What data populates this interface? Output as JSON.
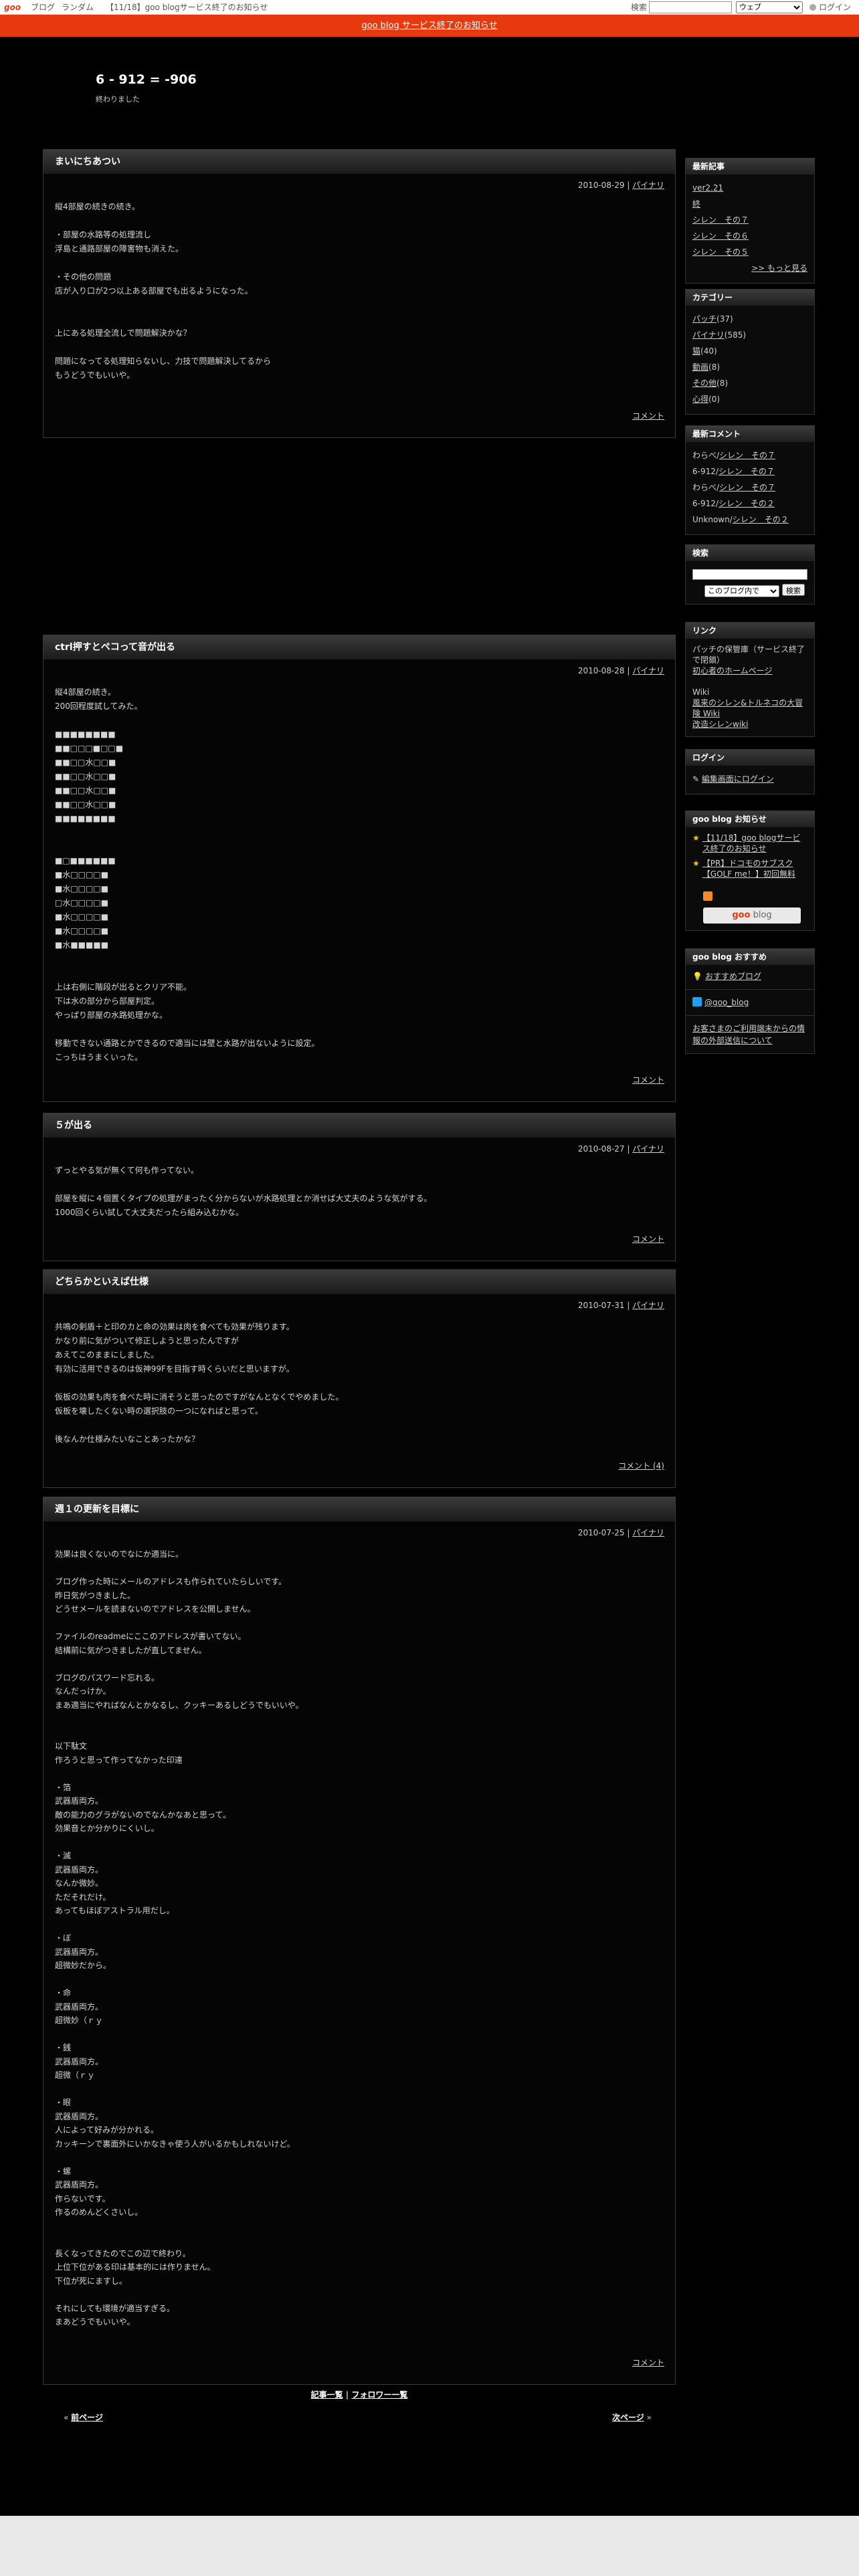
{
  "topbar": {
    "logo": "goo",
    "links": [
      "ブログ",
      "ランダム",
      "【11/18】goo blogサービス終了のお知らせ"
    ],
    "search_label": "検索",
    "search_select": "ウェブ",
    "login": "ログイン"
  },
  "notice": "goo blog サービス終了のお知らせ",
  "blog": {
    "title": "6 - 912 = -906",
    "description": "終わりました"
  },
  "entries": [
    {
      "title": "まいにちあつい",
      "date": "2010-08-29",
      "author": "パイナリ",
      "body": "縦4部屋の続きの続き。\n\n・部屋の水路等の処理流し\n浮島と通路部屋の障害物も消えた。\n\n・その他の問題\n店が入り口が2つ以上ある部屋でも出るようになった。\n\n\n上にある処理全流しで問題解決かな？\n\n問題になってる処理知らないし、力技で問題解決してるから\nもうどうでもいいや。",
      "comment": "コメント"
    },
    {
      "title": "ctrl押すとペコって音が出る",
      "date": "2010-08-28",
      "author": "パイナリ",
      "body": "縦4部屋の続き。\n200回程度試してみた。\n\n■■■■■■■■\n■■□□□■□□■\n■■□□水□□■\n■■□□水□□■\n■■□□水□□■\n■■□□水□□■\n■■■■■■■■\n\n\n■□■■■■■■\n■水□□□□■\n■水□□□□■\n□水□□□□■\n■水□□□□■\n■水□□□□■\n■水■■■■■\n\n\n上は右側に階段が出るとクリア不能。\n下は水の部分から部屋判定。\nやっぱり部屋の水路処理かな。\n\n移動できない通路とかできるので適当には壁と水路が出ないように設定。\nこっちはうまくいった。",
      "comment": "コメント"
    },
    {
      "title": "５が出る",
      "date": "2010-08-27",
      "author": "パイナリ",
      "body": "ずっとやる気が無くて何も作ってない。\n\n部屋を縦に４個置くタイプの処理がまったく分からないが水路処理とか消せば大丈夫のような気がする。\n1000回くらい試して大丈夫だったら組み込むかな。",
      "comment": "コメント"
    },
    {
      "title": "どちらかといえば仕様",
      "date": "2010-07-31",
      "author": "パイナリ",
      "body": "共鳴の剣盾＋と印のカと命の効果は肉を食べても効果が残ります。\nかなり前に気がついて修正しようと思ったんですが\nあえてこのままにしました。\n有効に活用できるのは仮神99Fを目指す時くらいだと思いますが。\n\n仮板の効果も肉を食べた時に消そうと思ったのですがなんとなくでやめました。\n仮板を壊したくない時の選択肢の一つになればと思って。\n\n後なんか仕様みたいなことあったかな？",
      "comment": "コメント (4)"
    },
    {
      "title": "週１の更新を目標に",
      "date": "2010-07-25",
      "author": "パイナリ",
      "body": "効果は良くないのでなにか適当に。\n\nブログ作った時にメールのアドレスも作られていたらしいです。\n昨日気がつきました。\nどうせメールを読まないのでアドレスを公開しません。\n\nファイルのreadmeにここのアドレスが書いてない。\n結構前に気がつきましたが直してません。\n\nブログのパスワード忘れる。\nなんだっけか。\nまあ適当にやればなんとかなるし、クッキーあるしどうでもいいや。\n\n\n以下駄文\n作ろうと思って作ってなかった印達\n\n・箔\n武器盾両方。\n敵の能力のグラがないのでなんかなあと思って。\n効果音とか分かりにくいし。\n\n・滅\n武器盾両方。\nなんか微妙。\nただそれだけ。\nあってもほぼアストラル用だし。\n\n・ぼ\n武器盾両方。\n超微妙だから。\n\n・命\n武器盾両方。\n超微妙（ｒｙ\n\n・銭\n武器盾両方。\n超微（ｒｙ\n\n・眼\n武器盾両方。\n人によって好みが分かれる。\nカッキーンで裏面外にいかなきゃ使う人がいるかもしれないけど。\n\n・螺\n武器盾両方。\n作らないです。\n作るのめんどくさいし。\n\n\n長くなってきたのでこの辺で終わり。\n上位下位がある印は基本的には作りません。\n下位が死にますし。\n\nそれにしても環境が適当すぎる。\nまあどうでもいいや。",
      "comment": "コメント"
    }
  ],
  "sidebar": {
    "recent_title": "最新記事",
    "recent": [
      "ver2.21",
      "終",
      "シレン　その７",
      "シレン　その６",
      "シレン　その５"
    ],
    "recent_more": ">> もっと見る",
    "category_title": "カテゴリー",
    "categories": [
      {
        "name": "パッチ",
        "count": "(37)"
      },
      {
        "name": "パイナリ",
        "count": "(585)"
      },
      {
        "name": "猫",
        "count": "(40)"
      },
      {
        "name": "動画",
        "count": "(8)"
      },
      {
        "name": "その他",
        "count": "(8)"
      },
      {
        "name": "心得",
        "count": "(0)"
      }
    ],
    "comments_title": "最新コメント",
    "comments": [
      {
        "who": "わらべ/",
        "link": "シレン　その７"
      },
      {
        "who": "6-912/",
        "link": "シレン　その７"
      },
      {
        "who": "わらべ/",
        "link": "シレン　その７"
      },
      {
        "who": "6-912/",
        "link": "シレン　その２"
      },
      {
        "who": "Unknown/",
        "link": "シレン　その２"
      }
    ],
    "search_title": "検索",
    "search_select": "このブログ内で",
    "search_button": "検索",
    "links_title": "リンク",
    "links": [
      "パッチの保管庫（サービス終了で閉鎖）",
      "初心者のホームページ",
      "",
      "Wiki",
      "風来のシレン&トルネコの大冒険 Wiki",
      "改造シレンwiki"
    ],
    "login_title": "ログイン",
    "login_link": "編集画面にログイン",
    "news_title": "goo blog お知らせ",
    "news": [
      "【11/18】goo blogサービス終了のお知らせ",
      "【PR】ドコモのサブスク【GOLF me！】初回無料"
    ],
    "badge_goo": "goo",
    "badge_blog": " blog",
    "recommend_title": "goo blog おすすめ",
    "recommend": "おすすめブログ",
    "twitter": "@goo_blog",
    "privacy": "お客さまのご利用端末からの情報の外部送信について"
  },
  "footer": {
    "list_link": "記事一覧",
    "follow_link": "フォロワー一覧",
    "separator": " | ",
    "prev_arrow": "« ",
    "prev": "前ページ",
    "next": "次ページ",
    "next_arrow": " »"
  }
}
